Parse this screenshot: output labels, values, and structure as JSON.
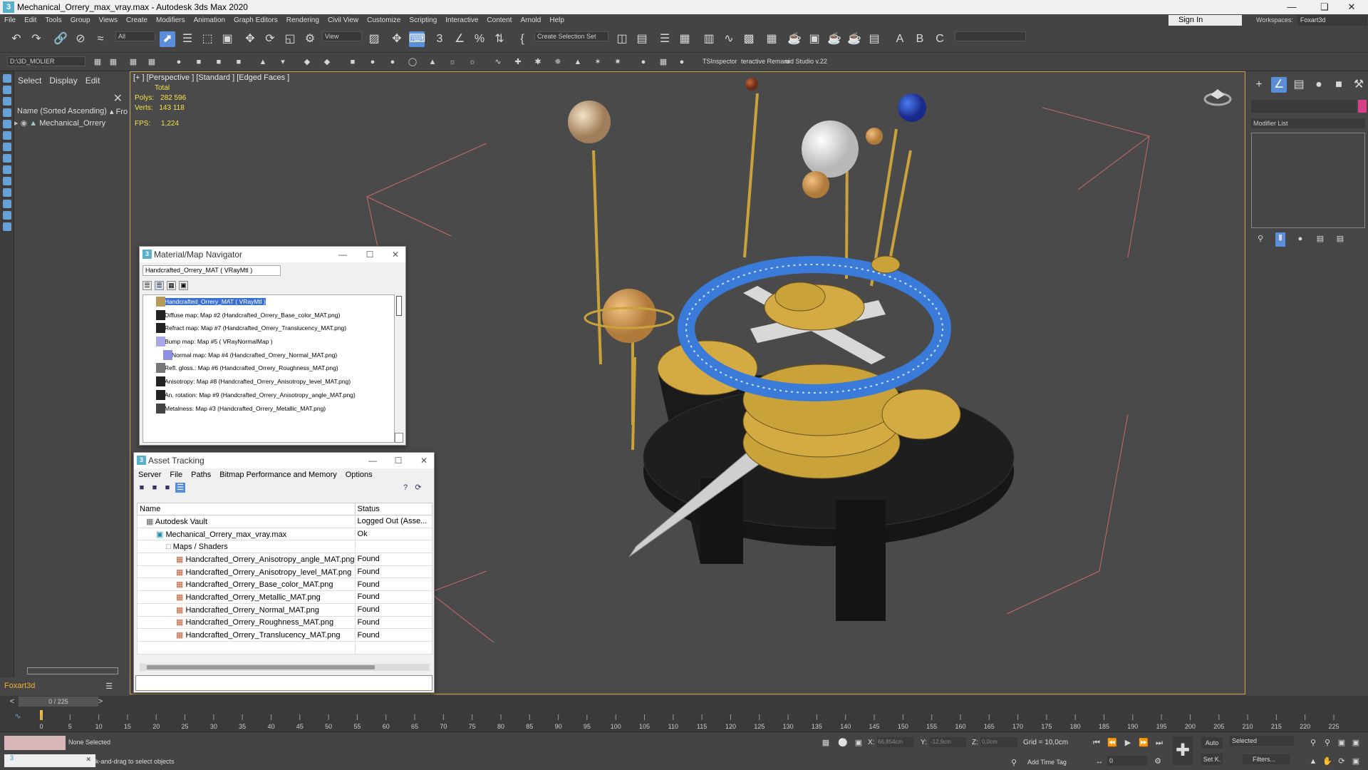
{
  "window": {
    "title": "Mechanical_Orrery_max_vray.max - Autodesk 3ds Max 2020",
    "app_icon": "3"
  },
  "menu": [
    "File",
    "Edit",
    "Tools",
    "Group",
    "Views",
    "Create",
    "Modifiers",
    "Animation",
    "Graph Editors",
    "Rendering",
    "Civil View",
    "Customize",
    "Scripting",
    "Interactive",
    "Content",
    "Arnold",
    "Help"
  ],
  "account": {
    "signin": "Sign In",
    "workspaces_label": "Workspaces:",
    "workspace": "Foxart3d"
  },
  "toolbar": {
    "selection_filter": "All",
    "ref_coord": "View",
    "selection_set": "Create Selection Set",
    "path": "D:\\3D_MOLIER",
    "plugin1": "TSInspector",
    "plugin2": "teractive Remam",
    "plugin3": "uid Studio v.22"
  },
  "scene_explorer": {
    "tabs": [
      "Select",
      "Display",
      "Edit"
    ],
    "column": "Name (Sorted Ascending)",
    "column2": "▴ Fro",
    "item": "Mechanical_Orrery"
  },
  "viewport": {
    "label": "[+ ] [Perspective ] [Standard ] [Edged Faces ]",
    "total_label": "Total",
    "polys_label": "Polys:",
    "polys": "282 596",
    "verts_label": "Verts:",
    "verts": "143 118",
    "fps_label": "FPS:",
    "fps": "1,224"
  },
  "command_panel": {
    "modifier_list": "Modifier List"
  },
  "material_navigator": {
    "title": "Material/Map Navigator",
    "material": "Handcrafted_Orrery_MAT  ( VRayMtl )",
    "rows": [
      "Handcrafted_Orrery_MAT  ( VRayMtl )",
      "Diffuse map: Map #2 (Handcrafted_Orrery_Base_color_MAT.png)",
      "Refract map: Map #7 (Handcrafted_Orrery_Translucency_MAT.png)",
      "Bump map: Map #5  ( VRayNormalMap )",
      "Normal map: Map #4 (Handcrafted_Orrery_Normal_MAT.png)",
      "Refl. gloss.: Map #6 (Handcrafted_Orrery_Roughness_MAT.png)",
      "Anisotropy: Map #8 (Handcrafted_Orrery_Anisotropy_level_MAT.png)",
      "An. rotation: Map #9 (Handcrafted_Orrery_Anisotropy_angle_MAT.png)",
      "Metalness: Map #3 (Handcrafted_Orrery_Metallic_MAT.png)"
    ]
  },
  "asset_tracking": {
    "title": "Asset Tracking",
    "menu": [
      "Server",
      "File",
      "Paths",
      "Bitmap Performance and Memory",
      "Options"
    ],
    "columns": [
      "Name",
      "Status"
    ],
    "rows": [
      {
        "name": "Autodesk Vault",
        "status": "Logged Out (Asse..."
      },
      {
        "name": "Mechanical_Orrery_max_vray.max",
        "status": "Ok"
      },
      {
        "name": "Maps / Shaders",
        "status": ""
      },
      {
        "name": "Handcrafted_Orrery_Anisotropy_angle_MAT.png",
        "status": "Found"
      },
      {
        "name": "Handcrafted_Orrery_Anisotropy_level_MAT.png",
        "status": "Found"
      },
      {
        "name": "Handcrafted_Orrery_Base_color_MAT.png",
        "status": "Found"
      },
      {
        "name": "Handcrafted_Orrery_Metallic_MAT.png",
        "status": "Found"
      },
      {
        "name": "Handcrafted_Orrery_Normal_MAT.png",
        "status": "Found"
      },
      {
        "name": "Handcrafted_Orrery_Roughness_MAT.png",
        "status": "Found"
      },
      {
        "name": "Handcrafted_Orrery_Translucency_MAT.png",
        "status": "Found"
      }
    ]
  },
  "timeline": {
    "frame": "0 / 225",
    "ticks": [
      "0",
      "5",
      "10",
      "15",
      "20",
      "25",
      "30",
      "35",
      "40",
      "45",
      "50",
      "55",
      "60",
      "65",
      "70",
      "75",
      "80",
      "85",
      "90",
      "95",
      "100",
      "105",
      "110",
      "115",
      "120",
      "125",
      "130",
      "135",
      "140",
      "145",
      "150",
      "155",
      "160",
      "165",
      "170",
      "175",
      "180",
      "185",
      "190",
      "195",
      "200",
      "205",
      "210",
      "215",
      "220",
      "225"
    ]
  },
  "status": {
    "user": "Foxart3d",
    "selection": "None Selected",
    "hint": "k-and-drag to select objects",
    "x_label": "X:",
    "x": "66,854cm",
    "y_label": "Y:",
    "y": "-12,9cm",
    "z_label": "Z:",
    "z": "0,0cm",
    "grid": "Grid = 10,0cm",
    "add_time_tag": "Add Time Tag",
    "auto": "Auto",
    "selected": "Selected",
    "setk": "Set K.",
    "filters": "Filters...",
    "frame_field": "0"
  }
}
